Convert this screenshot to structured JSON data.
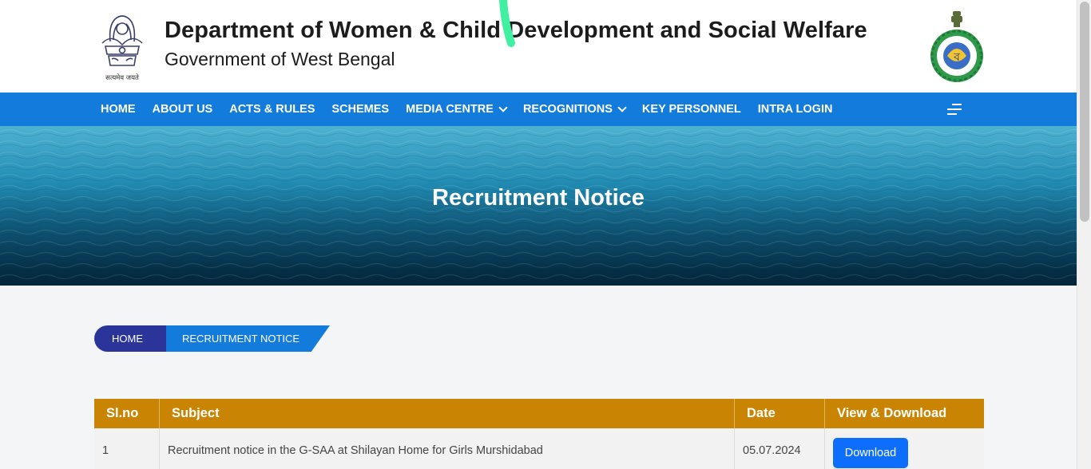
{
  "header": {
    "emblem_caption": "सत्यमेव जयते",
    "title": "Department of Women & Child Development and Social Welfare",
    "subtitle": "Government of West Bengal"
  },
  "nav": {
    "items": [
      {
        "label": "HOME",
        "dropdown": false
      },
      {
        "label": "ABOUT US",
        "dropdown": false
      },
      {
        "label": "ACTS & RULES",
        "dropdown": false
      },
      {
        "label": "SCHEMES",
        "dropdown": false
      },
      {
        "label": "MEDIA CENTRE",
        "dropdown": true
      },
      {
        "label": "RECOGNITIONS",
        "dropdown": true
      },
      {
        "label": "KEY PERSONNEL",
        "dropdown": false
      },
      {
        "label": "INTRA LOGIN",
        "dropdown": false
      }
    ],
    "menu_icon": "menu-icon"
  },
  "banner": {
    "title": "Recruitment Notice"
  },
  "breadcrumb": {
    "home": "HOME",
    "current": "RECRUITMENT NOTICE"
  },
  "table": {
    "headers": [
      "Sl.no",
      "Subject",
      "Date",
      "View & Download"
    ],
    "rows": [
      {
        "slno": "1",
        "subject": "Recruitment notice in the G-SAA at Shilayan Home for Girls Murshidabad",
        "date": "05.07.2024",
        "action": "Download"
      }
    ]
  },
  "colors": {
    "nav_blue": "#137bdc",
    "breadcrumb_home": "#2b3499",
    "table_header": "#c98403",
    "button_blue": "#0d6efd",
    "marker_green": "#3ef0a0"
  }
}
